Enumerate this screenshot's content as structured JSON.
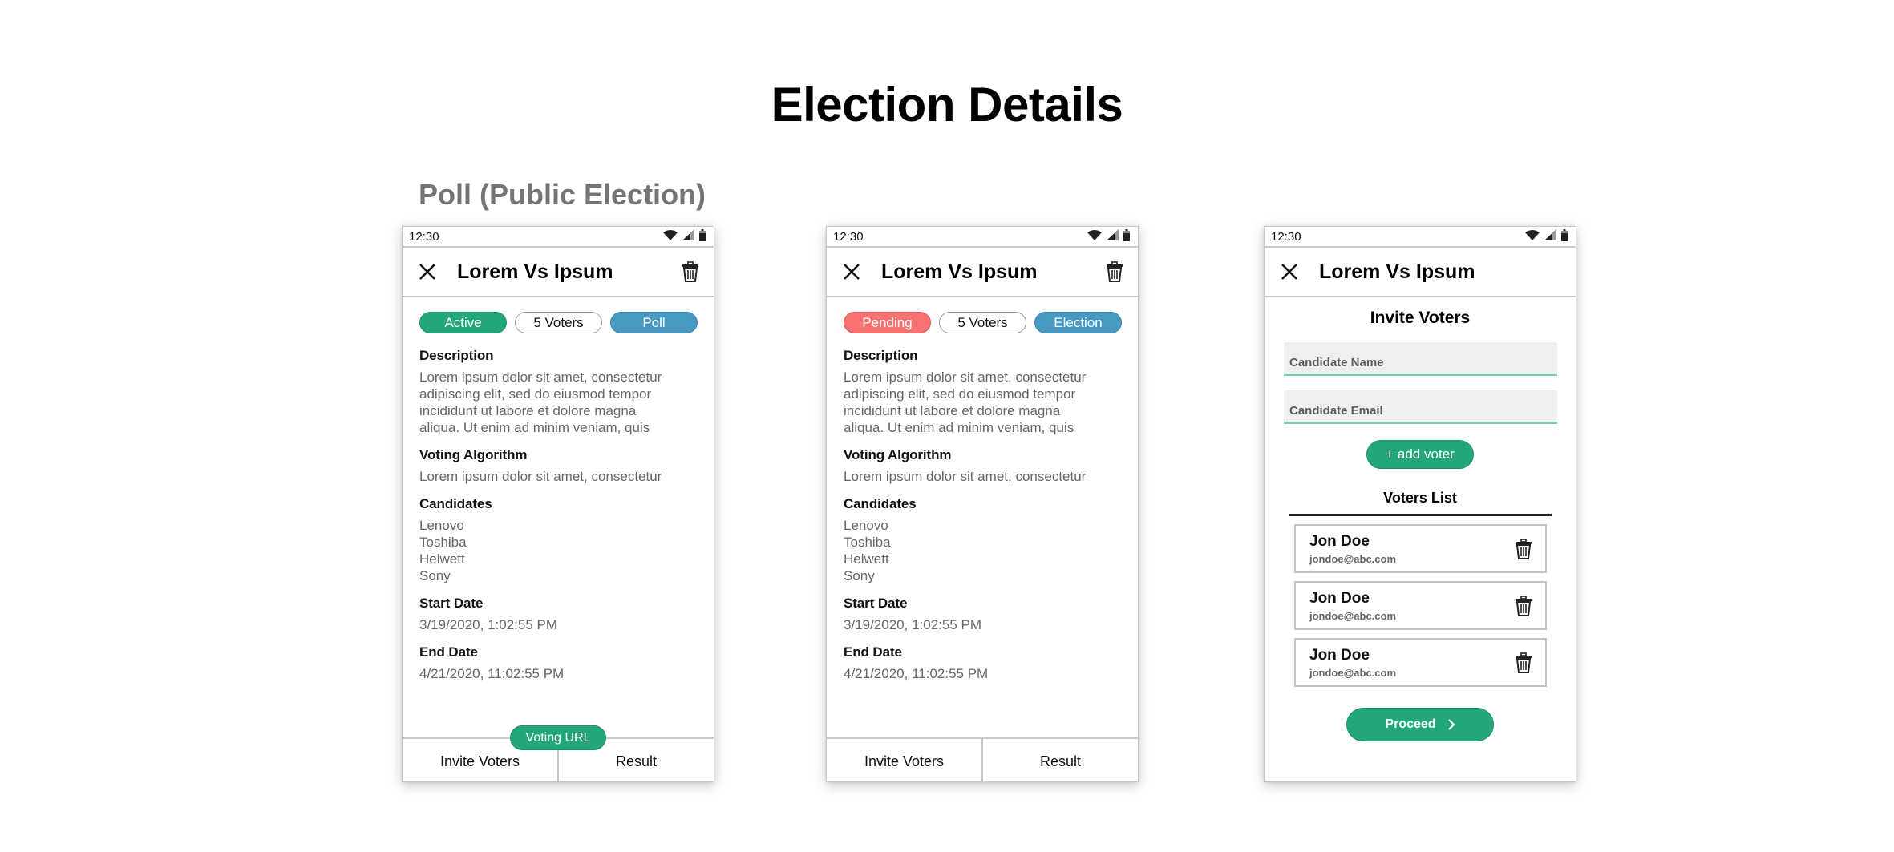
{
  "page": {
    "title": "Election Details",
    "section_label": "Poll (Public Election)"
  },
  "colors": {
    "green": "#23a77a",
    "red": "#f77171",
    "blue": "#4799c2",
    "input_underline": "#7ccbaa"
  },
  "status_bar": {
    "time": "12:30",
    "icons": [
      "wifi-icon",
      "signal-icon",
      "battery-icon"
    ]
  },
  "screens": [
    {
      "header_title": "Lorem Vs Ipsum",
      "chips": [
        {
          "label": "Active",
          "kind": "status"
        },
        {
          "label": "5 Voters",
          "kind": "count"
        },
        {
          "label": "Poll",
          "kind": "type"
        }
      ],
      "fields": {
        "description_label": "Description",
        "description_lines": [
          "Lorem ipsum dolor sit amet, consectetur",
          "adipiscing elit, sed do eiusmod tempor",
          "incididunt ut labore et dolore magna",
          "aliqua. Ut enim ad minim veniam, quis"
        ],
        "algorithm_label": "Voting Algorithm",
        "algorithm_value": "Lorem ipsum dolor sit amet, consectetur",
        "candidates_label": "Candidates",
        "candidates": [
          "Lenovo",
          "Toshiba",
          "Helwett",
          "Sony"
        ],
        "start_label": "Start Date",
        "start_value": "3/19/2020, 1:02:55 PM",
        "end_label": "End Date",
        "end_value": "4/21/2020, 11:02:55 PM"
      },
      "voting_url_label": "Voting URL",
      "tabs": [
        "Invite Voters",
        "Result"
      ]
    },
    {
      "header_title": "Lorem Vs Ipsum",
      "chips": [
        {
          "label": "Pending",
          "kind": "status"
        },
        {
          "label": "5 Voters",
          "kind": "count"
        },
        {
          "label": "Election",
          "kind": "type"
        }
      ],
      "fields": {
        "description_label": "Description",
        "description_lines": [
          "Lorem ipsum dolor sit amet, consectetur",
          "adipiscing elit, sed do eiusmod tempor",
          "incididunt ut labore et dolore magna",
          "aliqua. Ut enim ad minim veniam, quis"
        ],
        "algorithm_label": "Voting Algorithm",
        "algorithm_value": "Lorem ipsum dolor sit amet, consectetur",
        "candidates_label": "Candidates",
        "candidates": [
          "Lenovo",
          "Toshiba",
          "Helwett",
          "Sony"
        ],
        "start_label": "Start Date",
        "start_value": "3/19/2020, 1:02:55 PM",
        "end_label": "End Date",
        "end_value": "4/21/2020, 11:02:55 PM"
      },
      "tabs": [
        "Invite Voters",
        "Result"
      ]
    },
    {
      "header_title": "Lorem Vs Ipsum",
      "invite_title": "Invite Voters",
      "name_placeholder": "Candidate Name",
      "email_placeholder": "Candidate Email",
      "add_voter_label": "+ add voter",
      "voters_list_title": "Voters List",
      "voters": [
        {
          "name": "Jon Doe",
          "email": "jondoe@abc.com"
        },
        {
          "name": "Jon Doe",
          "email": "jondoe@abc.com"
        },
        {
          "name": "Jon Doe",
          "email": "jondoe@abc.com"
        }
      ],
      "proceed_label": "Proceed"
    }
  ]
}
